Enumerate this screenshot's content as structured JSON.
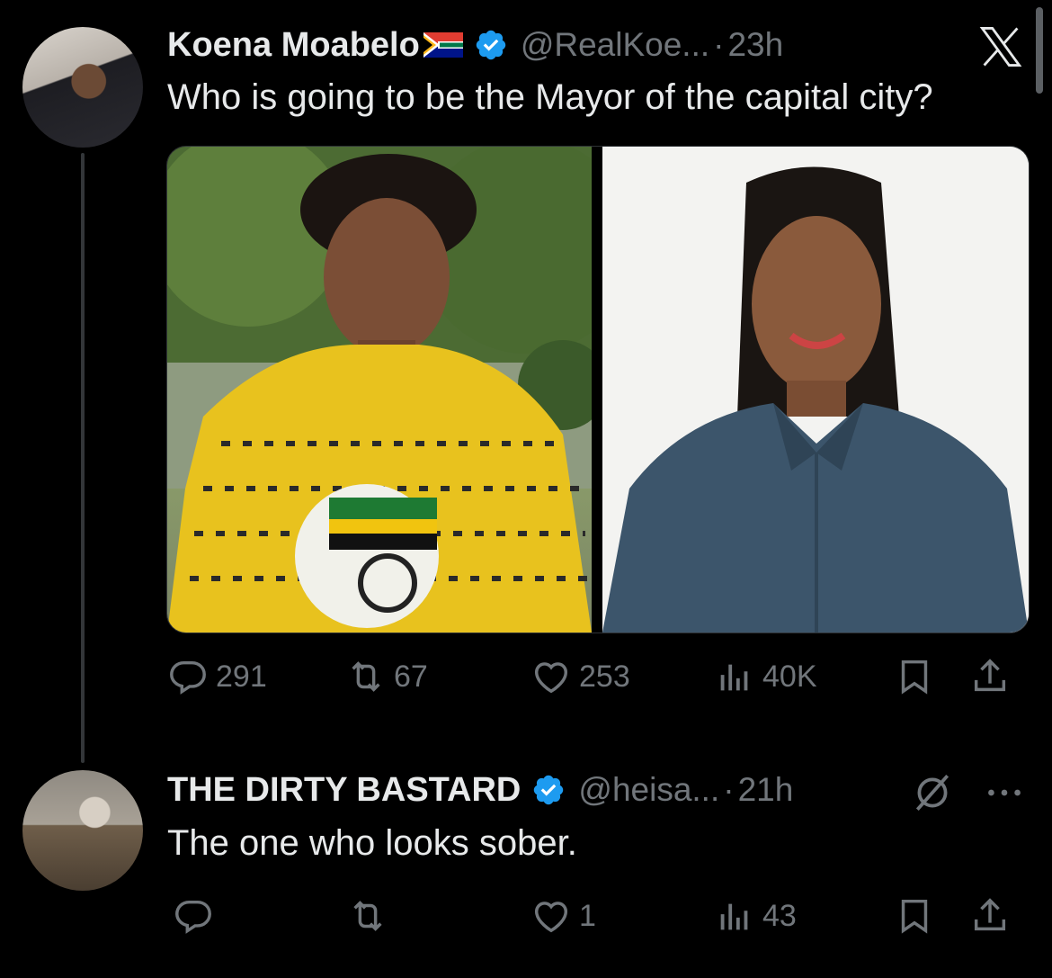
{
  "tweet": {
    "author_name": "Koena Moabelo",
    "author_flag": "south-africa-flag",
    "handle": "@RealKoe...",
    "separator": "·",
    "time": "23h",
    "text": "Who is going to be the Mayor of the capital city?",
    "photos": [
      "woman-in-yellow-anc-jacket-photo",
      "woman-in-blue-shirt-photo"
    ],
    "stats": {
      "replies": "291",
      "reposts": "67",
      "likes": "253",
      "views": "40K"
    }
  },
  "reply": {
    "author_name": "THE DIRTY BASTARD",
    "handle": "@heisa...",
    "separator": "·",
    "time": "21h",
    "text": "The one who looks sober.",
    "stats": {
      "replies": "",
      "reposts": "",
      "likes": "1",
      "views": "43"
    }
  },
  "colors": {
    "background": "#000000",
    "text": "#e7e9ea",
    "muted": "#71767b",
    "verified": "#1d9bf0"
  }
}
